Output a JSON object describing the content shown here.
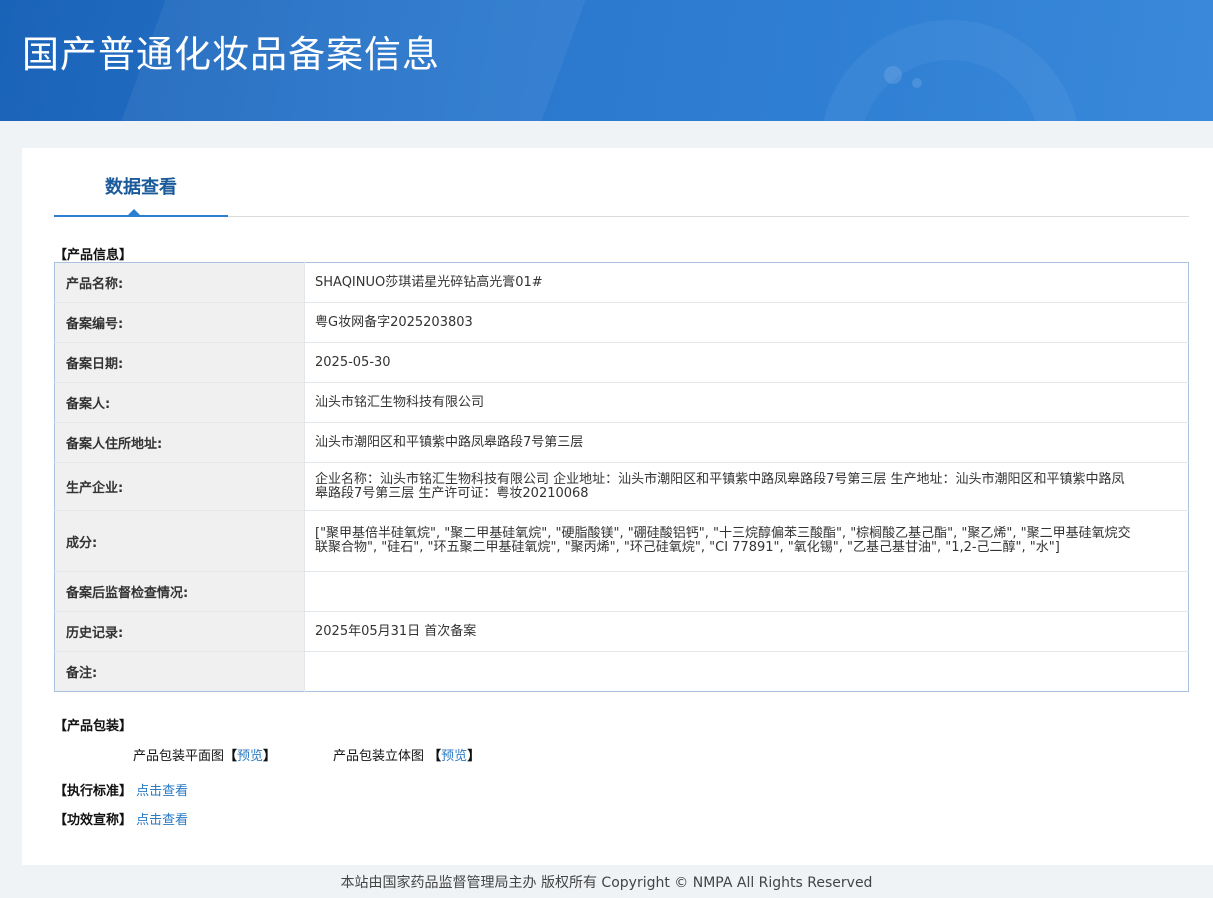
{
  "header": {
    "title": "国产普通化妆品备案信息"
  },
  "tab": {
    "label": "数据查看"
  },
  "product_info": {
    "section_title": "【产品信息】",
    "rows": [
      {
        "label": "产品名称:",
        "value": "SHAQINUO莎琪诺星光碎钻高光膏01#"
      },
      {
        "label": "备案编号:",
        "value": "粤G妆网备字2025203803"
      },
      {
        "label": "备案日期:",
        "value": "2025-05-30"
      },
      {
        "label": "备案人:",
        "value": "汕头市铭汇生物科技有限公司"
      },
      {
        "label": "备案人住所地址:",
        "value": "汕头市潮阳区和平镇紫中路凤皋路段7号第三层"
      },
      {
        "label": "生产企业:",
        "value": "企业名称：汕头市铭汇生物科技有限公司 企业地址：汕头市潮阳区和平镇紫中路凤皋路段7号第三层 生产地址：汕头市潮阳区和平镇紫中路凤皋路段7号第三层 生产许可证：粤妆20210068"
      },
      {
        "label": "成分:",
        "value": "[\"聚甲基倍半硅氧烷\", \"聚二甲基硅氧烷\", \"硬脂酸镁\", \"硼硅酸铝钙\", \"十三烷醇偏苯三酸酯\", \"棕榈酸乙基己酯\", \"聚乙烯\", \"聚二甲基硅氧烷交联聚合物\", \"硅石\", \"环五聚二甲基硅氧烷\", \"聚丙烯\", \"环己硅氧烷\", \"CI 77891\", \"氧化锡\", \"乙基己基甘油\", \"1,2-己二醇\", \"水\"]"
      },
      {
        "label": "备案后监督检查情况:",
        "value": ""
      },
      {
        "label": "历史记录:",
        "value": "2025年05月31日 首次备案"
      },
      {
        "label": "备注:",
        "value": ""
      }
    ]
  },
  "packaging": {
    "section_title": "【产品包装】",
    "flat_label": "产品包装平面图",
    "flat_link": "预览",
    "stereo_label": "产品包装立体图",
    "stereo_link": "预览",
    "bracket_open": "【",
    "bracket_close": "】"
  },
  "standard": {
    "section_title": "【执行标准】",
    "link": "点击查看"
  },
  "efficacy": {
    "section_title": "【功效宣称】",
    "link": "点击查看"
  },
  "footer": {
    "text": "本站由国家药品监督管理局主办 版权所有 Copyright © NMPA All Rights Reserved"
  }
}
